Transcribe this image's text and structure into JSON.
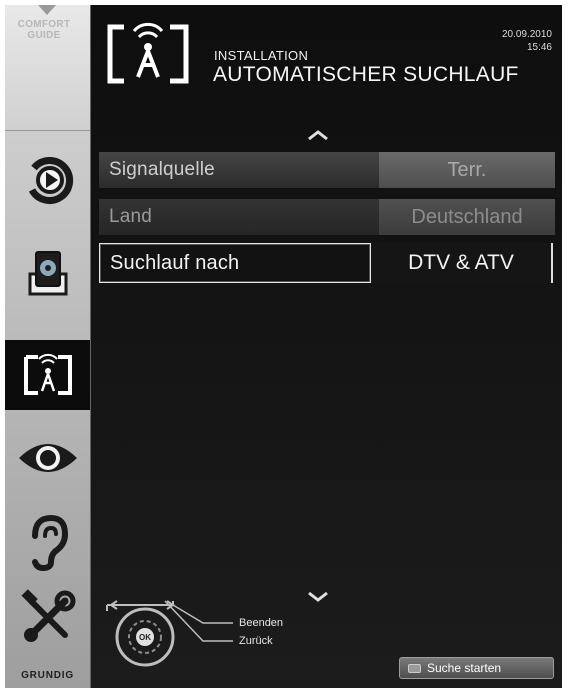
{
  "sidebar": {
    "comfort_guide": "COMFORT\nGUIDE",
    "items": [
      {
        "icon": "source-icon"
      },
      {
        "icon": "media-icon"
      },
      {
        "icon": "installation-icon",
        "active": true
      },
      {
        "icon": "picture-icon"
      },
      {
        "icon": "sound-icon"
      },
      {
        "icon": "settings-icon"
      }
    ],
    "brand": "GRUNDIG"
  },
  "header": {
    "subtitle": "INSTALLATION",
    "title": "AUTOMATISCHER SUCHLAUF",
    "date": "20.09.2010",
    "time": "15:46"
  },
  "menu": {
    "rows": [
      {
        "label": "Signalquelle",
        "value": "Terr."
      },
      {
        "label": "Land",
        "value": "Deutschland"
      },
      {
        "label": "Suchlauf nach",
        "value": "DTV & ATV"
      }
    ]
  },
  "footer": {
    "remote_ok": "OK",
    "exit_label": "Beenden",
    "back_label": "Zurück",
    "start_button": "Suche starten"
  }
}
